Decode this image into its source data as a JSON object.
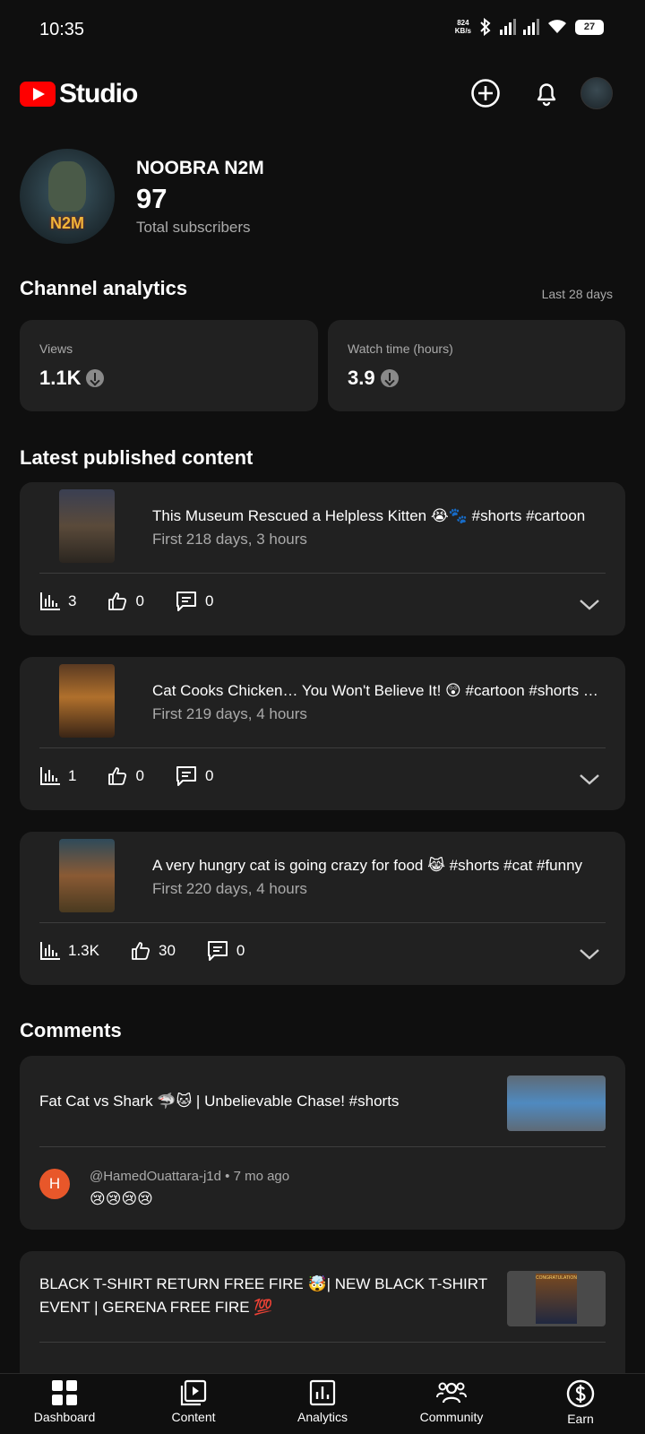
{
  "status_bar": {
    "time": "10:35",
    "net_speed_value": "824",
    "net_speed_unit": "KB/s",
    "battery": "27"
  },
  "header": {
    "logo_text": "Studio",
    "create_icon": "create-icon",
    "notification_icon": "bell-icon"
  },
  "channel": {
    "name": "NOOBRA N2M",
    "subscriber_count": "97",
    "subscriber_label": "Total subscribers",
    "avatar_text": "N2M"
  },
  "analytics": {
    "title": "Channel analytics",
    "period": "Last 28 days",
    "metrics": [
      {
        "label": "Views",
        "value": "1.1K",
        "trend_icon": "down-arrow-icon"
      },
      {
        "label": "Watch time (hours)",
        "value": "3.9",
        "trend_icon": "down-arrow-icon"
      }
    ]
  },
  "latest": {
    "title": "Latest published content",
    "items": [
      {
        "title": "This Museum Rescued a Helpless Kitten 😭🐾 #shorts #cartoon",
        "subtitle": "First 218 days, 3 hours",
        "views": "3",
        "likes": "0",
        "comments": "0"
      },
      {
        "title": "Cat Cooks Chicken… You Won't Believe It! 😲 #cartoon #shorts #cat",
        "subtitle": "First 219 days, 4 hours",
        "views": "1",
        "likes": "0",
        "comments": "0"
      },
      {
        "title": "A very hungry cat is going crazy for food 😹 #shorts #cat #funny",
        "subtitle": "First 220 days, 4 hours",
        "views": "1.3K",
        "likes": "30",
        "comments": "0"
      }
    ]
  },
  "comments": {
    "title": "Comments",
    "items": [
      {
        "video_title": "Fat Cat vs Shark 🦈🐱 | Unbelievable Chase! #shorts",
        "avatar_letter": "H",
        "author": "@HamedOuattara-j1d",
        "age": "7 mo ago",
        "text": "😢😢😢😢"
      },
      {
        "video_title_line1": "BLACK T-SHIRT RETURN FREE FIRE 🤯| NEW BLACK T-SHIRT",
        "video_title_line2": "EVENT | GERENA FREE FIRE 💯",
        "thumb_text": "CONGRATULATIONS"
      }
    ]
  },
  "bottom_nav": [
    {
      "label": "Dashboard",
      "icon": "dashboard-icon"
    },
    {
      "label": "Content",
      "icon": "content-icon"
    },
    {
      "label": "Analytics",
      "icon": "analytics-icon"
    },
    {
      "label": "Community",
      "icon": "community-icon"
    },
    {
      "label": "Earn",
      "icon": "earn-icon"
    }
  ],
  "colors": {
    "background": "#0f0f0f",
    "card": "#212121",
    "brand_red": "#ff0000",
    "muted_text": "#aaaaaa"
  }
}
